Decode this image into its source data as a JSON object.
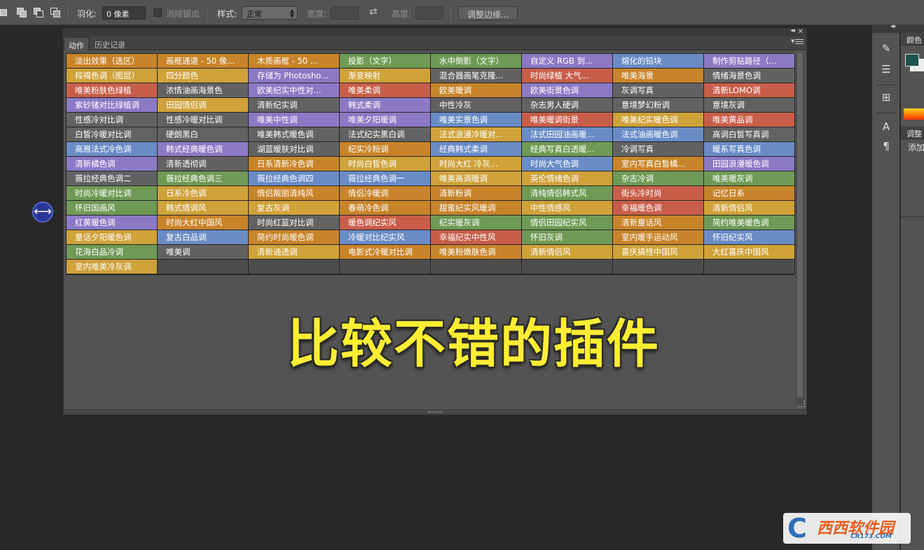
{
  "options_bar": {
    "feather_label": "羽化:",
    "feather_value": "0 像素",
    "antialias_label": "消除锯齿",
    "style_label": "样式:",
    "style_value": "正常",
    "width_label": "宽度:",
    "height_label": "高度:",
    "refine_edge_button": "调整边缘..."
  },
  "panel": {
    "tabs": [
      {
        "label": "动作",
        "active": true
      },
      {
        "label": "历史记录",
        "active": false
      }
    ],
    "actions": [
      {
        "label": "淡出效果（选区）",
        "color": "#c8842a"
      },
      {
        "label": "画框通道 - 50 像...",
        "color": "#c8842a"
      },
      {
        "label": "木质画框 - 50 ...",
        "color": "#c8842a"
      },
      {
        "label": "投影（文字）",
        "color": "#6f9a55"
      },
      {
        "label": "水中倒影（文字）",
        "color": "#6f9a55"
      },
      {
        "label": "自定义 RGB 到...",
        "color": "#8c79c4"
      },
      {
        "label": "熔化的铅块",
        "color": "#6a8cc6"
      },
      {
        "label": "制作剪贴路径（...",
        "color": "#8c79c4"
      },
      {
        "label": "棕褐色调（图层）",
        "color": "#cfa23a"
      },
      {
        "label": "四分颜色",
        "color": "#cfa23a"
      },
      {
        "label": "存储为 Photosho...",
        "color": "#8c79c4"
      },
      {
        "label": "渐变映射",
        "color": "#cfa23a"
      },
      {
        "label": "混合器画笔克隆...",
        "color": "#626262"
      },
      {
        "label": "时尚绿植 大气...",
        "color": "#c85e4a"
      },
      {
        "label": "唯美海景",
        "color": "#c8842a"
      },
      {
        "label": "情绪海景色调",
        "color": "#626262"
      },
      {
        "label": "唯美粉肤色绿植",
        "color": "#c85e4a"
      },
      {
        "label": "浓情油画海景色",
        "color": "#626262"
      },
      {
        "label": "欧美纪实中性对...",
        "color": "#8c79c4"
      },
      {
        "label": "唯美柔调",
        "color": "#c85e4a"
      },
      {
        "label": "欧美暖调",
        "color": "#c8842a"
      },
      {
        "label": "欧美街景色调",
        "color": "#8c79c4"
      },
      {
        "label": "灰调写真",
        "color": "#626262"
      },
      {
        "label": "清新LOMO调",
        "color": "#c85e4a"
      },
      {
        "label": "紫砂锗对比绿植调",
        "color": "#8c79c4"
      },
      {
        "label": "田园情侣调",
        "color": "#cfa23a"
      },
      {
        "label": "清新纪实调",
        "color": "#626262"
      },
      {
        "label": "韩式柔调",
        "color": "#8c79c4"
      },
      {
        "label": "中性冷灰",
        "color": "#626262"
      },
      {
        "label": "杂志男人硬调",
        "color": "#626262"
      },
      {
        "label": "意境梦幻粉调",
        "color": "#626262"
      },
      {
        "label": "意境灰调",
        "color": "#626262"
      },
      {
        "label": "性感冷对比调",
        "color": "#626262"
      },
      {
        "label": "性感冷暖对比调",
        "color": "#626262"
      },
      {
        "label": "唯美中性调",
        "color": "#8c79c4"
      },
      {
        "label": "唯美夕阳暖调",
        "color": "#8c79c4"
      },
      {
        "label": "唯美实景色调",
        "color": "#6a8cc6"
      },
      {
        "label": "唯美暖调街景",
        "color": "#c85e4a"
      },
      {
        "label": "唯美纪实暖色调",
        "color": "#cfa23a"
      },
      {
        "label": "唯美黄品调",
        "color": "#c85e4a"
      },
      {
        "label": "白皙冷暖对比调",
        "color": "#626262"
      },
      {
        "label": "硬朗黑白",
        "color": "#626262"
      },
      {
        "label": "唯美韩式暖色调",
        "color": "#626262"
      },
      {
        "label": "法式纪实黑白调",
        "color": "#626262"
      },
      {
        "label": "法式浪漫冷暖对...",
        "color": "#cfa23a"
      },
      {
        "label": "法式田园油画暖...",
        "color": "#6a8cc6"
      },
      {
        "label": "法式油画暖色调",
        "color": "#6a8cc6"
      },
      {
        "label": "高调白皙写真调",
        "color": "#626262"
      },
      {
        "label": "高雅法式冷色调",
        "color": "#6a8cc6"
      },
      {
        "label": "韩式经典暖色调",
        "color": "#8c79c4"
      },
      {
        "label": "湖蓝暖肤对比调",
        "color": "#626262"
      },
      {
        "label": "纪实冷粉调",
        "color": "#c8842a"
      },
      {
        "label": "经典韩式柔调",
        "color": "#6a8cc6"
      },
      {
        "label": "经典写真白透暖...",
        "color": "#6f9a55"
      },
      {
        "label": "冷调写真",
        "color": "#626262"
      },
      {
        "label": "暖系写真色调",
        "color": "#6a8cc6"
      },
      {
        "label": "清新橘色调",
        "color": "#8c79c4"
      },
      {
        "label": "清新透彻调",
        "color": "#626262"
      },
      {
        "label": "日系清新冷色调",
        "color": "#c8842a"
      },
      {
        "label": "时尚白皙色调",
        "color": "#cfa23a"
      },
      {
        "label": "时尚大红 冷灰...",
        "color": "#cfa23a"
      },
      {
        "label": "时尚大气色调",
        "color": "#6a8cc6"
      },
      {
        "label": "室内写真白皙橘...",
        "color": "#c8842a"
      },
      {
        "label": "田园浪漫暖色调",
        "color": "#8c79c4"
      },
      {
        "label": "薇拉经典色调二",
        "color": "#626262"
      },
      {
        "label": "薇拉经典色调三",
        "color": "#6f9a55"
      },
      {
        "label": "薇拉经典色调四",
        "color": "#6a8cc6"
      },
      {
        "label": "薇拉经典色调一",
        "color": "#6a8cc6"
      },
      {
        "label": "唯美高调暖调",
        "color": "#cfa23a"
      },
      {
        "label": "英伦情绪色调",
        "color": "#cfa23a"
      },
      {
        "label": "杂志冷调",
        "color": "#6f9a55"
      },
      {
        "label": "唯美暖灰调",
        "color": "#6f9a55"
      },
      {
        "label": "时尚冷暖对比调",
        "color": "#6f9a55"
      },
      {
        "label": "日系冷色调",
        "color": "#cfa23a"
      },
      {
        "label": "情侣靓丽清纯风",
        "color": "#c8842a"
      },
      {
        "label": "情侣冷暖调",
        "color": "#c8842a"
      },
      {
        "label": "清新粉调",
        "color": "#c8842a"
      },
      {
        "label": "清纯情侣韩式风",
        "color": "#6f9a55"
      },
      {
        "label": "街头冷时尚",
        "color": "#c85e4a"
      },
      {
        "label": "记忆日系",
        "color": "#c8842a"
      },
      {
        "label": "怀旧国画风",
        "color": "#6f9a55"
      },
      {
        "label": "韩式情调风",
        "color": "#cfa23a"
      },
      {
        "label": "复古灰调",
        "color": "#cfa23a"
      },
      {
        "label": "春萌冷色调",
        "color": "#c8842a"
      },
      {
        "label": "甜蜜纪实风暖调",
        "color": "#c8842a"
      },
      {
        "label": "中性情感风",
        "color": "#cfa23a"
      },
      {
        "label": "幸福暖色调",
        "color": "#c85e4a"
      },
      {
        "label": "清新情侣风",
        "color": "#cfa23a"
      },
      {
        "label": "红黄暖色调",
        "color": "#8c79c4"
      },
      {
        "label": "时尚大红中国风",
        "color": "#c8842a"
      },
      {
        "label": "时尚红蓝对比调",
        "color": "#626262"
      },
      {
        "label": "暖色调纪实风",
        "color": "#c85e4a"
      },
      {
        "label": "纪实暖灰调",
        "color": "#6f9a55"
      },
      {
        "label": "情侣田园纪实风",
        "color": "#6f9a55"
      },
      {
        "label": "清新童话风",
        "color": "#c8842a"
      },
      {
        "label": "简约唯美暖色调",
        "color": "#6f9a55"
      },
      {
        "label": "童话夕阳暖色调",
        "color": "#cfa23a"
      },
      {
        "label": "复古白品调",
        "color": "#6a8cc6"
      },
      {
        "label": "简约时尚暖色调",
        "color": "#c8842a"
      },
      {
        "label": "冷暖对比纪实风",
        "color": "#6a8cc6"
      },
      {
        "label": "幸福纪实中性风",
        "color": "#c85e4a"
      },
      {
        "label": "怀旧灰调",
        "color": "#6f9a55"
      },
      {
        "label": "室内暖手运动风",
        "color": "#c8842a"
      },
      {
        "label": "怀旧纪实风",
        "color": "#6a8cc6"
      },
      {
        "label": "花海白品冷调",
        "color": "#6f9a55"
      },
      {
        "label": "唯美调",
        "color": "#626262"
      },
      {
        "label": "清新通透调",
        "color": "#cfa23a"
      },
      {
        "label": "电影式冷暖对比调",
        "color": "#c8842a"
      },
      {
        "label": "唯美粉嫩肤色调",
        "color": "#c8842a"
      },
      {
        "label": "清新情侣风",
        "color": "#cfa23a"
      },
      {
        "label": "喜庆搞怪中国风",
        "color": "#cfa23a"
      },
      {
        "label": "大红喜庆中国风",
        "color": "#cfa23a"
      },
      {
        "label": "室内唯美冷灰调",
        "color": "#cfa23a"
      }
    ],
    "empty_cells": 7
  },
  "caption": "比较不错的插件",
  "right_panel": {
    "color_tab": "颜色",
    "adjust_tab": "调整",
    "add_label": "添加"
  },
  "watermark": {
    "brand": "西西软件园",
    "url": "CR173.COM"
  }
}
